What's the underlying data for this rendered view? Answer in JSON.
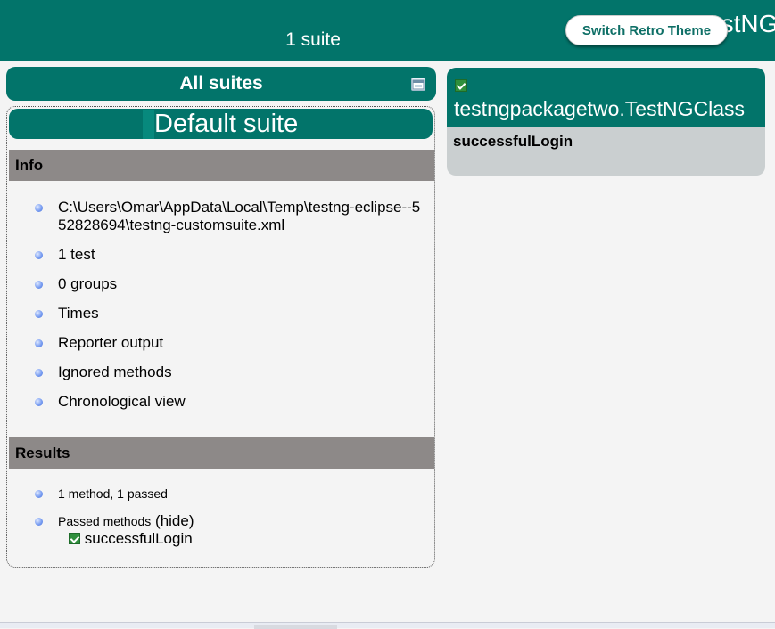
{
  "header": {
    "title": "TestNG Results",
    "suite_count": "1 suite",
    "theme_button": "Switch Retro Theme"
  },
  "all_suites": {
    "label": "All suites",
    "collapse_icon": "collapse-window-icon"
  },
  "suite": {
    "name": "Default suite",
    "info": {
      "heading": "Info",
      "path": "C:\\Users\\Omar\\AppData\\Local\\Temp\\testng-eclipse--552828694\\testng-customsuite.xml",
      "items": [
        "1 test",
        "0 groups",
        "Times",
        "Reporter output",
        "Ignored methods",
        "Chronological view"
      ]
    },
    "results": {
      "heading": "Results",
      "summary": "1 method, 1 passed",
      "passed_label": "Passed methods",
      "hide_link": "(hide)",
      "passed_methods": [
        "successfulLogin"
      ]
    }
  },
  "class_panel": {
    "class_name": "testngpackagetwo.TestNGClass",
    "methods": [
      "successfulLogin"
    ]
  },
  "colors": {
    "header_bg": "#02746a",
    "section_bg": "#8d8988",
    "pass_green": "#2f8f3c",
    "class_card_bg": "#cacfd0"
  }
}
